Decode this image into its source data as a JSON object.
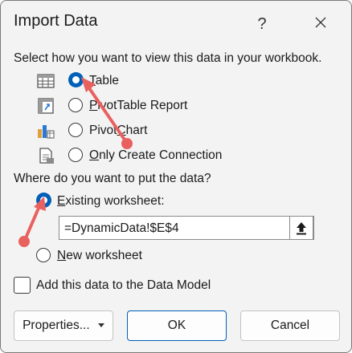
{
  "dialog": {
    "title": "Import Data",
    "help_label": "?",
    "view_prompt": "Select how you want to view this data in your workbook.",
    "view_options": [
      {
        "pre": "",
        "u": "T",
        "post": "able",
        "icon": "table-icon",
        "checked": true
      },
      {
        "pre": "",
        "u": "P",
        "post": "ivotTable Report",
        "icon": "pivottable-icon",
        "checked": false
      },
      {
        "pre": "Pivot",
        "u": "C",
        "post": "hart",
        "icon": "pivotchart-icon",
        "checked": false
      },
      {
        "pre": "",
        "u": "O",
        "post": "nly Create Connection",
        "icon": "connection-icon",
        "checked": false
      }
    ],
    "location_prompt": "Where do you want to put the data?",
    "existing": {
      "u": "E",
      "post": "xisting worksheet:",
      "checked": true
    },
    "range_value": "=DynamicData!$E$4",
    "new_sheet": {
      "u": "N",
      "post": "ew worksheet",
      "checked": false
    },
    "data_model_label": "Add this data to the Data Model",
    "data_model_checked": false,
    "buttons": {
      "properties": "Properties...",
      "ok": "OK",
      "cancel": "Cancel"
    }
  },
  "colors": {
    "accent": "#005fb8",
    "annotation_arrow": "#e8615f"
  }
}
